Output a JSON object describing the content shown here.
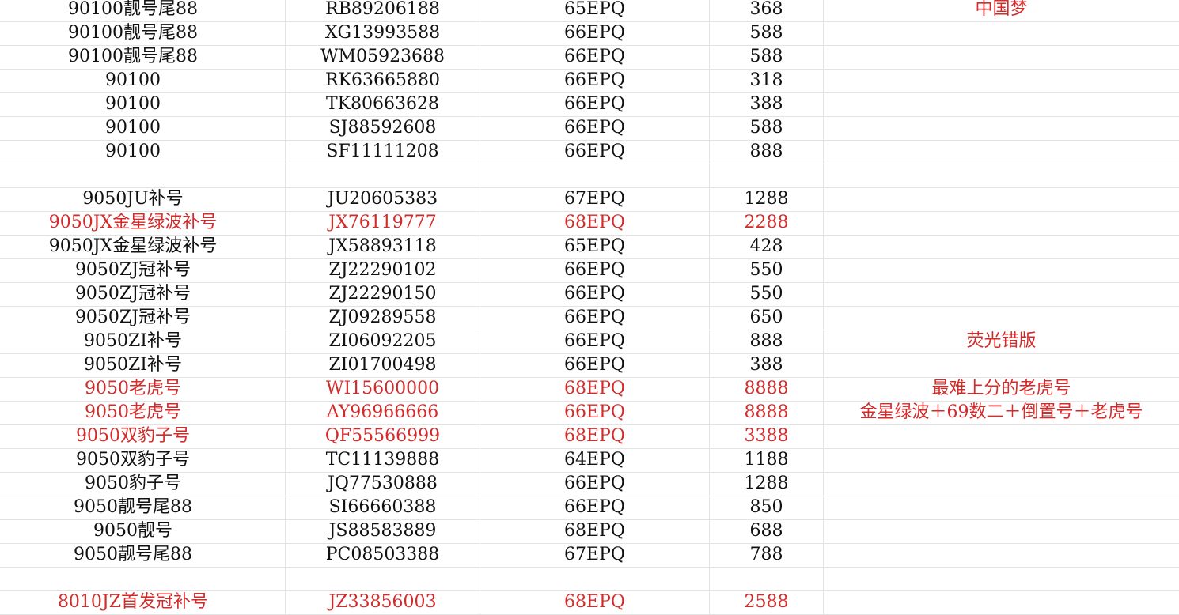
{
  "colors": {
    "text": "#111111",
    "highlight": "#d42a2a",
    "grid": "#e3e3e3"
  },
  "rows": [
    {
      "name": "90100靓号尾88",
      "serial": "RB89206188",
      "grade": "65EPQ",
      "price": "368",
      "note": "中国梦",
      "red": false,
      "note_red": true
    },
    {
      "name": "90100靓号尾88",
      "serial": "XG13993588",
      "grade": "66EPQ",
      "price": "588",
      "note": "",
      "red": false
    },
    {
      "name": "90100靓号尾88",
      "serial": "WM05923688",
      "grade": "66EPQ",
      "price": "588",
      "note": "",
      "red": false
    },
    {
      "name": "90100",
      "serial": "RK63665880",
      "grade": "66EPQ",
      "price": "318",
      "note": "",
      "red": false
    },
    {
      "name": "90100",
      "serial": "TK80663628",
      "grade": "66EPQ",
      "price": "388",
      "note": "",
      "red": false
    },
    {
      "name": "90100",
      "serial": "SJ88592608",
      "grade": "66EPQ",
      "price": "588",
      "note": "",
      "red": false
    },
    {
      "name": "90100",
      "serial": "SF11111208",
      "grade": "66EPQ",
      "price": "888",
      "note": "",
      "red": false
    },
    {
      "name": "",
      "serial": "",
      "grade": "",
      "price": "",
      "note": "",
      "red": false
    },
    {
      "name": "9050JU补号",
      "serial": "JU20605383",
      "grade": "67EPQ",
      "price": "1288",
      "note": "",
      "red": false
    },
    {
      "name": "9050JX金星绿波补号",
      "serial": "JX76119777",
      "grade": "68EPQ",
      "price": "2288",
      "note": "",
      "red": true
    },
    {
      "name": "9050JX金星绿波补号",
      "serial": "JX58893118",
      "grade": "65EPQ",
      "price": "428",
      "note": "",
      "red": false
    },
    {
      "name": "9050ZJ冠补号",
      "serial": "ZJ22290102",
      "grade": "66EPQ",
      "price": "550",
      "note": "",
      "red": false
    },
    {
      "name": "9050ZJ冠补号",
      "serial": "ZJ22290150",
      "grade": "66EPQ",
      "price": "550",
      "note": "",
      "red": false
    },
    {
      "name": "9050ZJ冠补号",
      "serial": "ZJ09289558",
      "grade": "66EPQ",
      "price": "650",
      "note": "",
      "red": false
    },
    {
      "name": "9050ZI补号",
      "serial": "ZI06092205",
      "grade": "66EPQ",
      "price": "888",
      "note": "荧光错版",
      "red": false,
      "note_red": true
    },
    {
      "name": "9050ZI补号",
      "serial": "ZI01700498",
      "grade": "66EPQ",
      "price": "388",
      "note": "",
      "red": false
    },
    {
      "name": "9050老虎号",
      "serial": "WI15600000",
      "grade": "68EPQ",
      "price": "8888",
      "note": "最难上分的老虎号",
      "red": true,
      "note_red": true
    },
    {
      "name": "9050老虎号",
      "serial": "AY96966666",
      "grade": "66EPQ",
      "price": "8888",
      "note": "金星绿波＋69数二＋倒置号＋老虎号",
      "red": true,
      "note_red": true
    },
    {
      "name": "9050双豹子号",
      "serial": "QF55566999",
      "grade": "68EPQ",
      "price": "3388",
      "note": "",
      "red": true
    },
    {
      "name": "9050双豹子号",
      "serial": "TC11139888",
      "grade": "64EPQ",
      "price": "1188",
      "note": "",
      "red": false
    },
    {
      "name": "9050豹子号",
      "serial": "JQ77530888",
      "grade": "66EPQ",
      "price": "1288",
      "note": "",
      "red": false
    },
    {
      "name": "9050靓号尾88",
      "serial": "SI66660388",
      "grade": "66EPQ",
      "price": "850",
      "note": "",
      "red": false
    },
    {
      "name": "9050靓号",
      "serial": "JS88583889",
      "grade": "68EPQ",
      "price": "688",
      "note": "",
      "red": false
    },
    {
      "name": "9050靓号尾88",
      "serial": "PC08503388",
      "grade": "67EPQ",
      "price": "788",
      "note": "",
      "red": false
    },
    {
      "name": "",
      "serial": "",
      "grade": "",
      "price": "",
      "note": "",
      "red": false
    },
    {
      "name": "8010JZ首发冠补号",
      "serial": "JZ33856003",
      "grade": "68EPQ",
      "price": "2588",
      "note": "",
      "red": true
    }
  ]
}
